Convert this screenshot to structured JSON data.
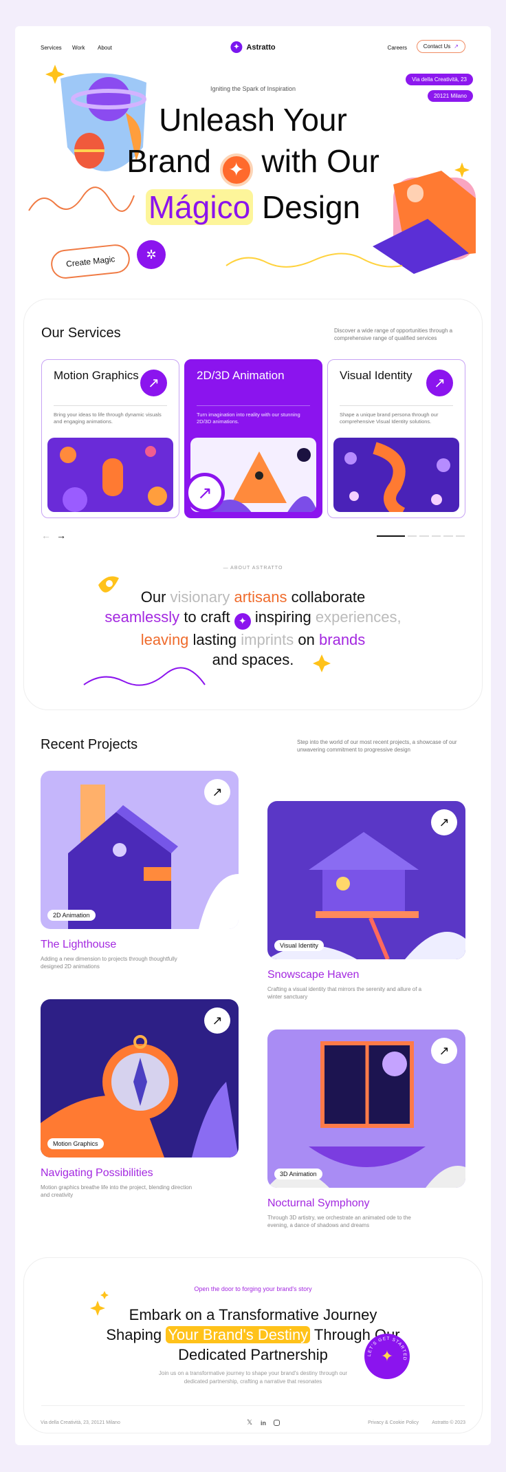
{
  "nav": {
    "services": "Services",
    "work": "Work",
    "about": "About",
    "brand": "Astratto",
    "careers": "Careers",
    "contact": "Contact Us"
  },
  "hero": {
    "address_line1": "Via della Creatività, 23",
    "address_line2": "20121 Milano",
    "subtitle": "Igniting the Spark of Inspiration",
    "title_line1": "Unleash Your",
    "title_line2a": "Brand",
    "title_line2b": "with Our",
    "title_magico": "Mágico",
    "title_line3b": "Design",
    "cta": "Create Magic"
  },
  "services": {
    "title": "Our Services",
    "description": "Discover a wide range of opportunities through a comprehensive range of qualified services",
    "cards": [
      {
        "title": "Motion Graphics",
        "text": "Bring your ideas to life through dynamic visuals and engaging animations."
      },
      {
        "title": "2D/3D Animation",
        "text": "Turn imagination into reality with our stunning 2D/3D animations."
      },
      {
        "title": "Visual Identity",
        "text": "Shape a unique brand persona through our comprehensive Visual Identity solutions."
      }
    ]
  },
  "about": {
    "tag": "ABOUT ASTRATTO",
    "w": [
      "Our",
      "visionary",
      "artisans",
      "collaborate",
      "seamlessly",
      "to craft",
      "inspiring",
      "experiences,",
      "leaving",
      "lasting",
      "imprints",
      "on",
      "brands",
      "and spaces."
    ]
  },
  "projects": {
    "title": "Recent Projects",
    "description": "Step into the world of our most recent projects, a showcase of our unwavering commitment to progressive design",
    "items": [
      {
        "tag": "2D Animation",
        "title": "The Lighthouse",
        "text": "Adding a new dimension to projects through thoughtfully designed 2D animations"
      },
      {
        "tag": "Visual Identity",
        "title": "Snowscape Haven",
        "text": "Crafting a visual identity that mirrors the serenity and allure of a winter sanctuary"
      },
      {
        "tag": "Motion Graphics",
        "title": "Navigating Possibilities",
        "text": "Motion graphics breathe life into the project, blending direction and creativity"
      },
      {
        "tag": "3D Animation",
        "title": "Nocturnal Symphony",
        "text": "Through 3D artistry, we orchestrate an animated ode to the evening, a dance of shadows and dreams"
      }
    ]
  },
  "cta": {
    "subtitle": "Open the door to forging your brand's story",
    "line1": "Embark on a Transformative Journey",
    "line2a": "Shaping",
    "highlight": "Your Brand's Destiny",
    "line2b": "Through Our",
    "line3": "Dedicated Partnership",
    "desc1": "Join us on a transformative journey to shape your brand's destiny through our",
    "desc2": "dedicated partnership, crafting a narrative that resonates",
    "badge": "LET'S GET STARTED"
  },
  "footer": {
    "address": "Via della Creatività, 23, 20121 Milano",
    "privacy": "Privacy & Cookie Policy",
    "copyright": "Astratto © 2023"
  },
  "colors": {
    "purple": "#8b14ee",
    "orange": "#ef6b2c",
    "yellow": "#ffc21a"
  }
}
